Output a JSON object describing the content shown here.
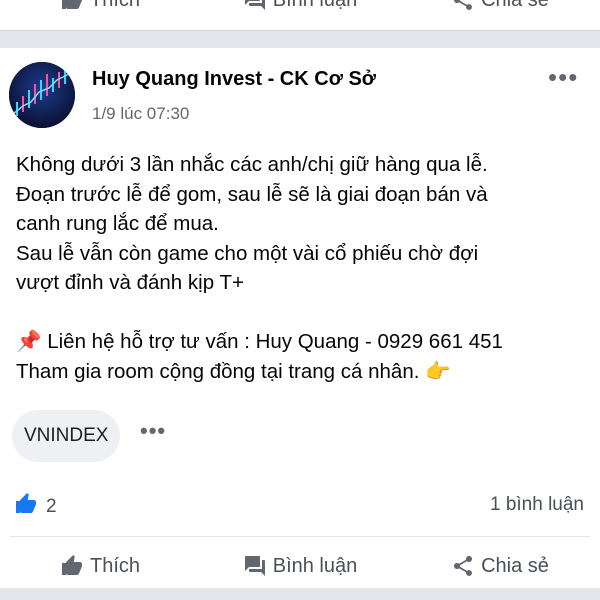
{
  "top_bar": {
    "like_label": "Thích",
    "comment_label": "Bình luận",
    "share_label": "Chia sẻ"
  },
  "post": {
    "author": "Huy Quang Invest - CK Cơ Sở",
    "timestamp": "1/9 lúc 07:30",
    "more_icon": "more-horizontal-icon",
    "lines": [
      "Không dưới 3 lần nhắc các anh/chị giữ hàng qua lễ.",
      "Đoạn trước lễ để gom, sau lễ sẽ là giai đoạn bán và",
      "canh rung lắc để mua.",
      "Sau lễ vẫn còn game cho một vài cổ phiếu chờ đợi",
      "vượt đỉnh và đánh kịp T+",
      "",
      "📌 Liên hệ hỗ trợ tư vấn : Huy Quang - 0929 661 451",
      "Tham gia room cộng đồng tại trang cá nhân. 👉"
    ],
    "tag": "VNINDEX",
    "more_tags_label": "•••",
    "like_count": "2",
    "comment_count": "1 bình luận"
  },
  "bottom_bar": {
    "like_label": "Thích",
    "comment_label": "Bình luận",
    "share_label": "Chia sẻ"
  },
  "colors": {
    "like_blue": "#1877f2",
    "text_gray": "#65676b",
    "divider": "#e4e6eb"
  }
}
